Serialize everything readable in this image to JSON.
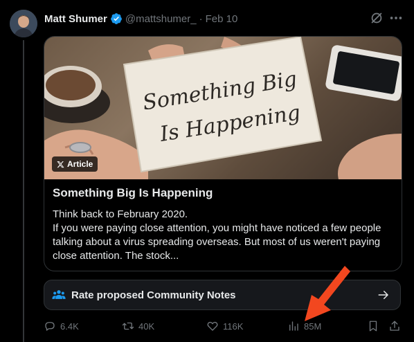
{
  "tweet": {
    "author_name": "Matt Shumer",
    "handle": "@mattshumer_",
    "separator": "·",
    "date": "Feb 10"
  },
  "card": {
    "image_caption_lines": [
      "Something Big",
      "Is Happening"
    ],
    "badge_label": "Article",
    "title": "Something Big Is Happening",
    "body": "Think back to February 2020.\nIf you were paying close attention, you might have noticed a few people talking about a virus spreading overseas. But most of us weren't paying close attention. The stock..."
  },
  "notes": {
    "label": "Rate proposed Community Notes"
  },
  "actions": {
    "replies": "6.4K",
    "reposts": "40K",
    "likes": "116K",
    "views": "85M"
  },
  "colors": {
    "accent_blue": "#1d9bf0",
    "annotation_arrow": "#f2471f"
  }
}
